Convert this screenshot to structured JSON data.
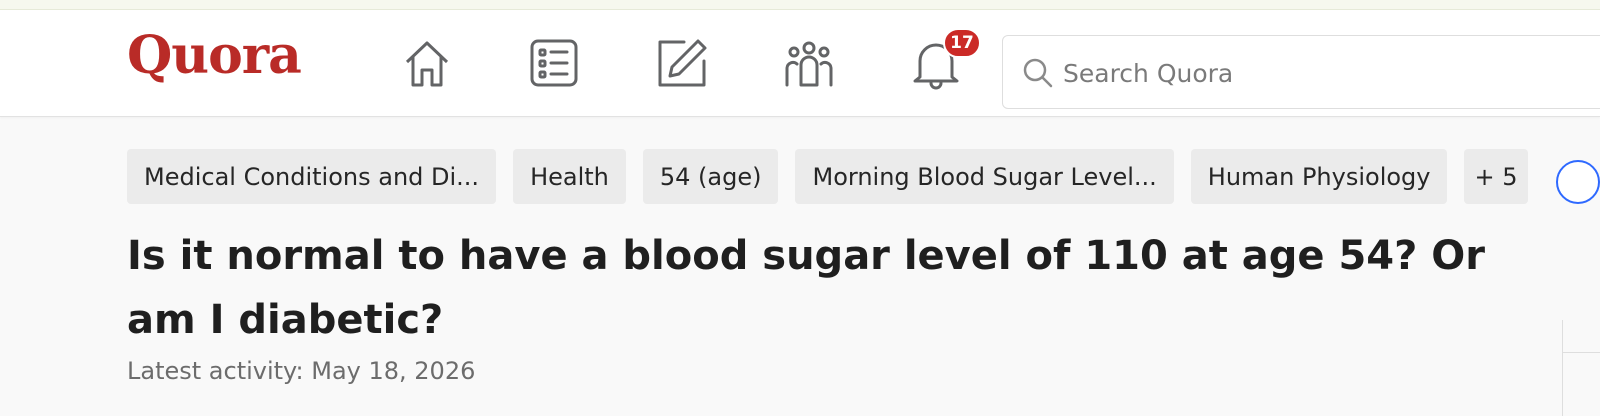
{
  "header": {
    "logo_text": "Quora",
    "nav_icons": [
      "home-icon",
      "following-list-icon",
      "answer-pencil-icon",
      "spaces-people-icon",
      "notifications-bell-icon"
    ],
    "notifications_count": "17",
    "search": {
      "placeholder": "Search Quora",
      "value": ""
    }
  },
  "topics": {
    "items": [
      "Medical Conditions and Di...",
      "Health",
      "54 (age)",
      "Morning Blood Sugar Level...",
      "Human Physiology"
    ],
    "more_label": "+ 5"
  },
  "question": {
    "title": "Is it normal to have a blood sugar level of 110 at age 54? Or am I diabetic?",
    "latest_activity": "Latest activity: May 18, 2026"
  },
  "colors": {
    "brand": "#b92b27",
    "badge": "#cb2a27",
    "tag_bg": "#ebebeb",
    "page_bg": "#f9f9f9",
    "accent_blue": "#2e69ff"
  }
}
